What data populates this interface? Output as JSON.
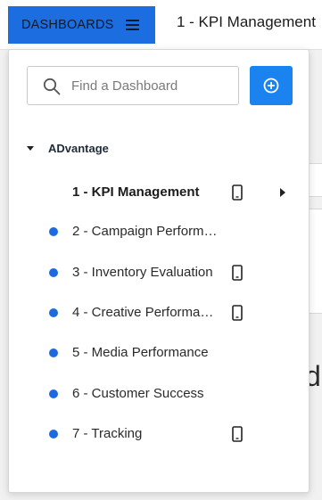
{
  "header": {
    "dashboards_button_label": "DASHBOARDS",
    "current_dashboard_title": "1 - KPI Management"
  },
  "background": {
    "partial_letter": "d"
  },
  "dropdown": {
    "search": {
      "placeholder": "Find a Dashboard",
      "value": ""
    },
    "add_button_icon": "plus-circle-icon",
    "group": {
      "label": "ADvantage",
      "expanded": true
    },
    "items": [
      {
        "label": "1 - KPI Management",
        "active": true,
        "mobile": true,
        "dot": false,
        "submenu": true
      },
      {
        "label": "2 - Campaign Perform…",
        "active": false,
        "mobile": false,
        "dot": true,
        "submenu": false
      },
      {
        "label": "3 - Inventory Evaluation",
        "active": false,
        "mobile": true,
        "dot": true,
        "submenu": false
      },
      {
        "label": "4 - Creative Performa…",
        "active": false,
        "mobile": true,
        "dot": true,
        "submenu": false
      },
      {
        "label": "5 - Media Performance",
        "active": false,
        "mobile": false,
        "dot": true,
        "submenu": false
      },
      {
        "label": "6 - Customer Success",
        "active": false,
        "mobile": false,
        "dot": true,
        "submenu": false
      },
      {
        "label": "7 - Tracking",
        "active": false,
        "mobile": true,
        "dot": true,
        "submenu": false
      }
    ]
  },
  "colors": {
    "primary_button": "#1c6ddf",
    "add_button": "#1a83f0",
    "dot": "#1d6ae0"
  }
}
